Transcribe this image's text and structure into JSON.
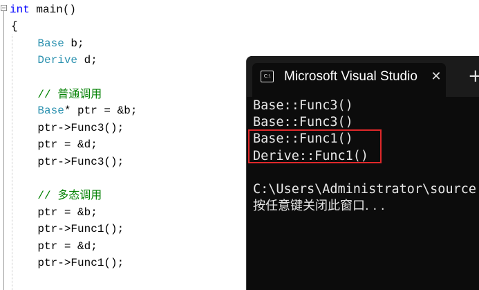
{
  "editor": {
    "lines": [
      {
        "tokens": [
          {
            "t": "int",
            "c": "kw"
          },
          {
            "t": " main()",
            "c": ""
          }
        ]
      },
      {
        "tokens": [
          {
            "t": "{",
            "c": ""
          }
        ]
      },
      {
        "tokens": [
          {
            "t": "    ",
            "c": ""
          },
          {
            "t": "Base",
            "c": "type"
          },
          {
            "t": " b;",
            "c": ""
          }
        ]
      },
      {
        "tokens": [
          {
            "t": "    ",
            "c": ""
          },
          {
            "t": "Derive",
            "c": "type"
          },
          {
            "t": " d;",
            "c": ""
          }
        ]
      },
      {
        "tokens": []
      },
      {
        "tokens": [
          {
            "t": "    ",
            "c": ""
          },
          {
            "t": "// ",
            "c": "cmt"
          },
          {
            "t": "普通调用",
            "c": "cmt cjk"
          }
        ]
      },
      {
        "tokens": [
          {
            "t": "    ",
            "c": ""
          },
          {
            "t": "Base",
            "c": "type"
          },
          {
            "t": "* ptr = &b;",
            "c": ""
          }
        ]
      },
      {
        "tokens": [
          {
            "t": "    ptr->Func3();",
            "c": ""
          }
        ]
      },
      {
        "tokens": [
          {
            "t": "    ptr = &d;",
            "c": ""
          }
        ]
      },
      {
        "tokens": [
          {
            "t": "    ptr->Func3();",
            "c": ""
          }
        ]
      },
      {
        "tokens": []
      },
      {
        "tokens": [
          {
            "t": "    ",
            "c": ""
          },
          {
            "t": "// ",
            "c": "cmt"
          },
          {
            "t": "多态调用",
            "c": "cmt cjk"
          }
        ]
      },
      {
        "tokens": [
          {
            "t": "    ptr = &b;",
            "c": ""
          }
        ]
      },
      {
        "tokens": [
          {
            "t": "    ptr->Func1();",
            "c": ""
          }
        ]
      },
      {
        "tokens": [
          {
            "t": "    ptr = &d;",
            "c": ""
          }
        ]
      },
      {
        "tokens": [
          {
            "t": "    ptr->Func1();",
            "c": ""
          }
        ]
      }
    ]
  },
  "console": {
    "tab_title": "Microsoft Visual Studio",
    "tab_icon_text": "C:\\",
    "close_glyph": "✕",
    "new_tab_glyph": "+",
    "output": [
      "Base::Func3()",
      "Base::Func3()",
      "Base::Func1()",
      "Derive::Func1()",
      "",
      "C:\\Users\\Administrator\\source",
      "按任意键关闭此窗口. . ."
    ]
  },
  "colors": {
    "keyword": "#0000ff",
    "type": "#2b91af",
    "comment": "#008000",
    "console_bg": "#0c0c0c",
    "highlight": "#e0282a"
  }
}
